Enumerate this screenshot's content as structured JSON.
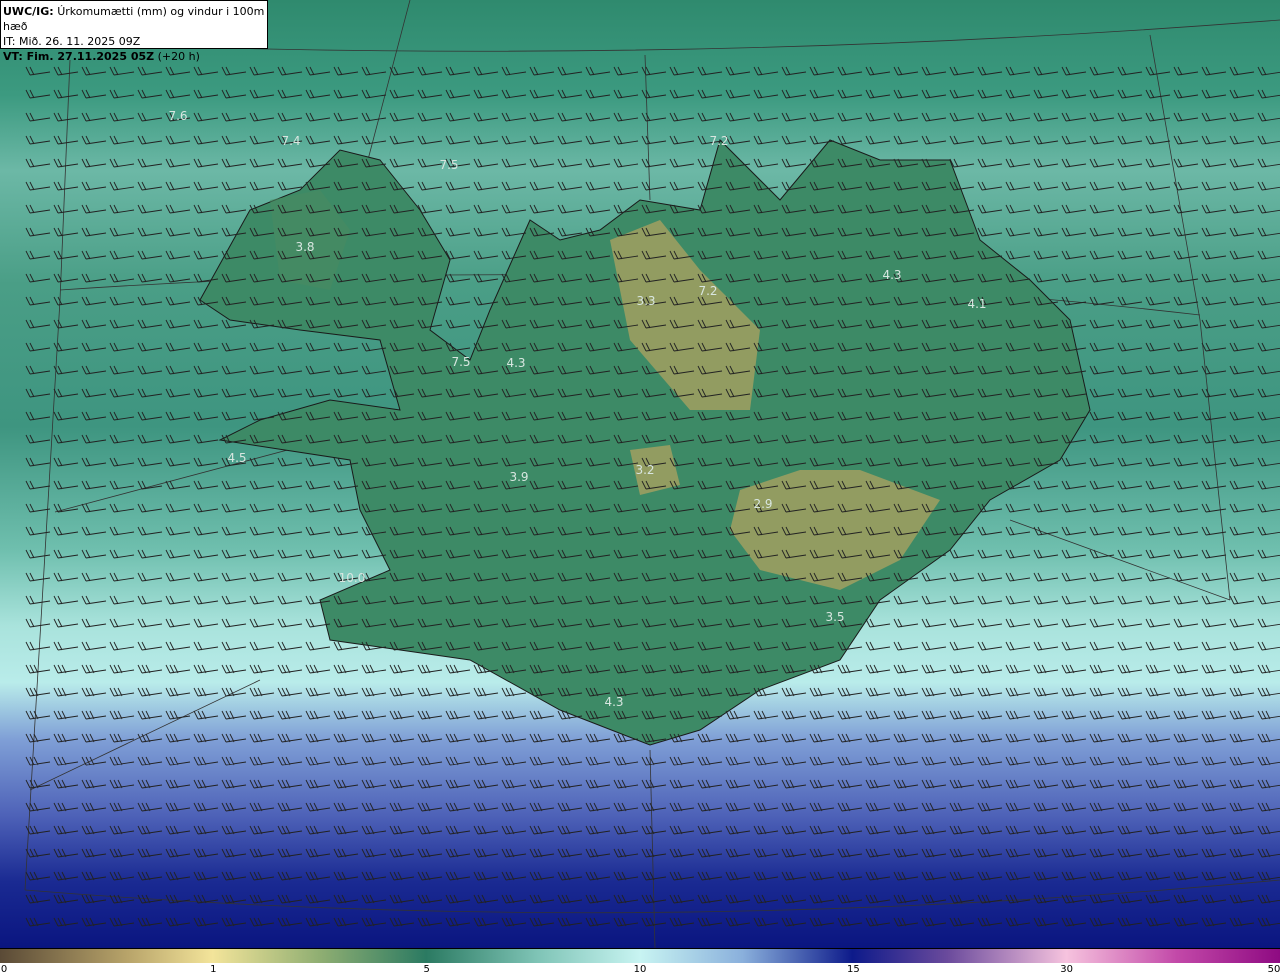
{
  "header": {
    "model": "UWC/IG:",
    "title": "Úrkomumætti (mm) og vindur i 100m hæð",
    "issue_time": "IT: Mið. 26. 11. 2025 09Z",
    "valid_prefix": "VT: Fim. 27.11.2025 05Z",
    "lead": "(+20 h)"
  },
  "map_labels": [
    "7.6",
    "7.4",
    "7.5",
    "7.2",
    "3.8",
    "3.3",
    "7.2",
    "4.3",
    "4.1",
    "7.5",
    "4.3",
    "4.5",
    "3.9",
    "3.2",
    "2.9",
    "10.0",
    "3.5",
    "4.3"
  ],
  "colorbar": {
    "ticks": [
      "0",
      "1",
      "5",
      "10",
      "15",
      "30",
      "50"
    ],
    "colors": [
      "#5a4a36",
      "#f3e49a",
      "#2b7a62",
      "#c8f4f2",
      "#0d1a8a",
      "#f6c3de",
      "#8e0a82"
    ]
  },
  "colors": {
    "land": "#3d8a66",
    "highland": "#a8a860",
    "sea_high": "#0a1580"
  }
}
